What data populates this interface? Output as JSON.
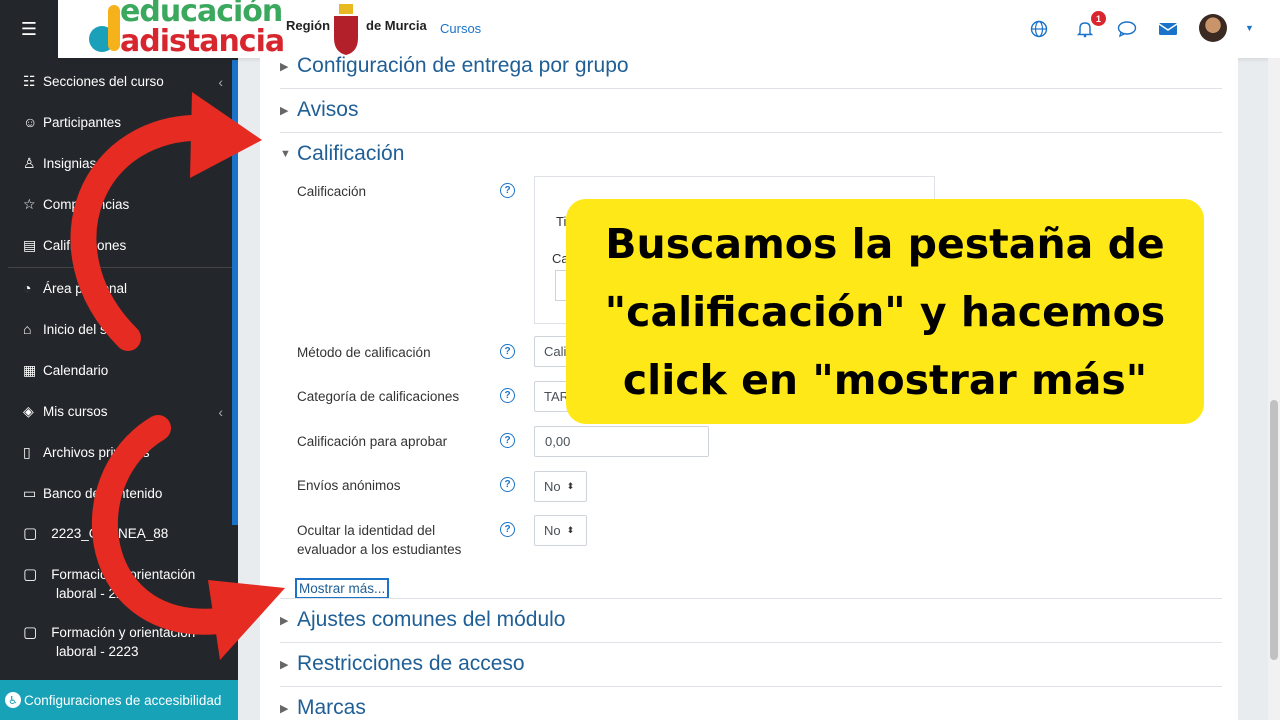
{
  "sidebar": {
    "items": [
      {
        "label": "Secciones del curso",
        "icon": "list-icon",
        "chevron": "‹"
      },
      {
        "label": "Participantes",
        "icon": "users-icon"
      },
      {
        "label": "Insignias",
        "icon": "badge-icon"
      },
      {
        "label": "Competencias",
        "icon": "star-icon"
      },
      {
        "label": "Calificaciones",
        "icon": "grades-icon"
      },
      {
        "label": "Área personal",
        "icon": "dashboard-icon"
      },
      {
        "label": "Inicio del sitio",
        "icon": "home-icon"
      },
      {
        "label": "Calendario",
        "icon": "calendar-icon"
      },
      {
        "label": "Mis cursos",
        "icon": "graduation-cap-icon",
        "chevron": "‹"
      },
      {
        "label": "Archivos privados",
        "icon": "file-icon"
      },
      {
        "label": "Banco de contenido",
        "icon": "clipboard-icon"
      }
    ],
    "folders": [
      {
        "label": "2223_OnLINEA_88"
      },
      {
        "label": "Formación y orientación laboral - 2223"
      },
      {
        "label": "Formación y orientación laboral - 2223"
      }
    ],
    "accessibility": "Configuraciones de accesibilidad"
  },
  "navbar": {
    "logo_top": "educación",
    "logo_bottom": "adistancia",
    "region": "Región",
    "murcia": "de Murcia",
    "cursos": "Cursos",
    "notification_count": "1"
  },
  "sections": {
    "group_delivery": "Configuración de entrega por grupo",
    "notices": "Avisos",
    "grading": "Calificación",
    "common": "Ajustes comunes del módulo",
    "restrictions": "Restricciones de acceso",
    "tags": "Marcas"
  },
  "form": {
    "grade_label": "Calificación",
    "grade_type_partial": "Ti",
    "grade_max_partial": "Ca",
    "method_label": "Método de calificación",
    "method_value": "Cali",
    "category_label": "Categoría de calificaciones",
    "category_value": "TAREAS",
    "pass_label": "Calificación para aprobar",
    "pass_value": "0,00",
    "anon_label": "Envíos anónimos",
    "anon_value": "No",
    "hide_label_1": "Ocultar la identidad del",
    "hide_label_2": "evaluador a los estudiantes",
    "hide_value": "No",
    "show_more": "Mostrar más..."
  },
  "callout": {
    "line1": "Buscamos la pestaña de",
    "line2": "\"calificación\" y hacemos",
    "line3": "click en \"mostrar más\""
  },
  "colors": {
    "sidebar_bg": "#23272b",
    "accent": "#1a73c9",
    "callout_bg": "#ffe817",
    "arrow": "#e52b22",
    "accessibility_bar": "#17a2b8"
  }
}
